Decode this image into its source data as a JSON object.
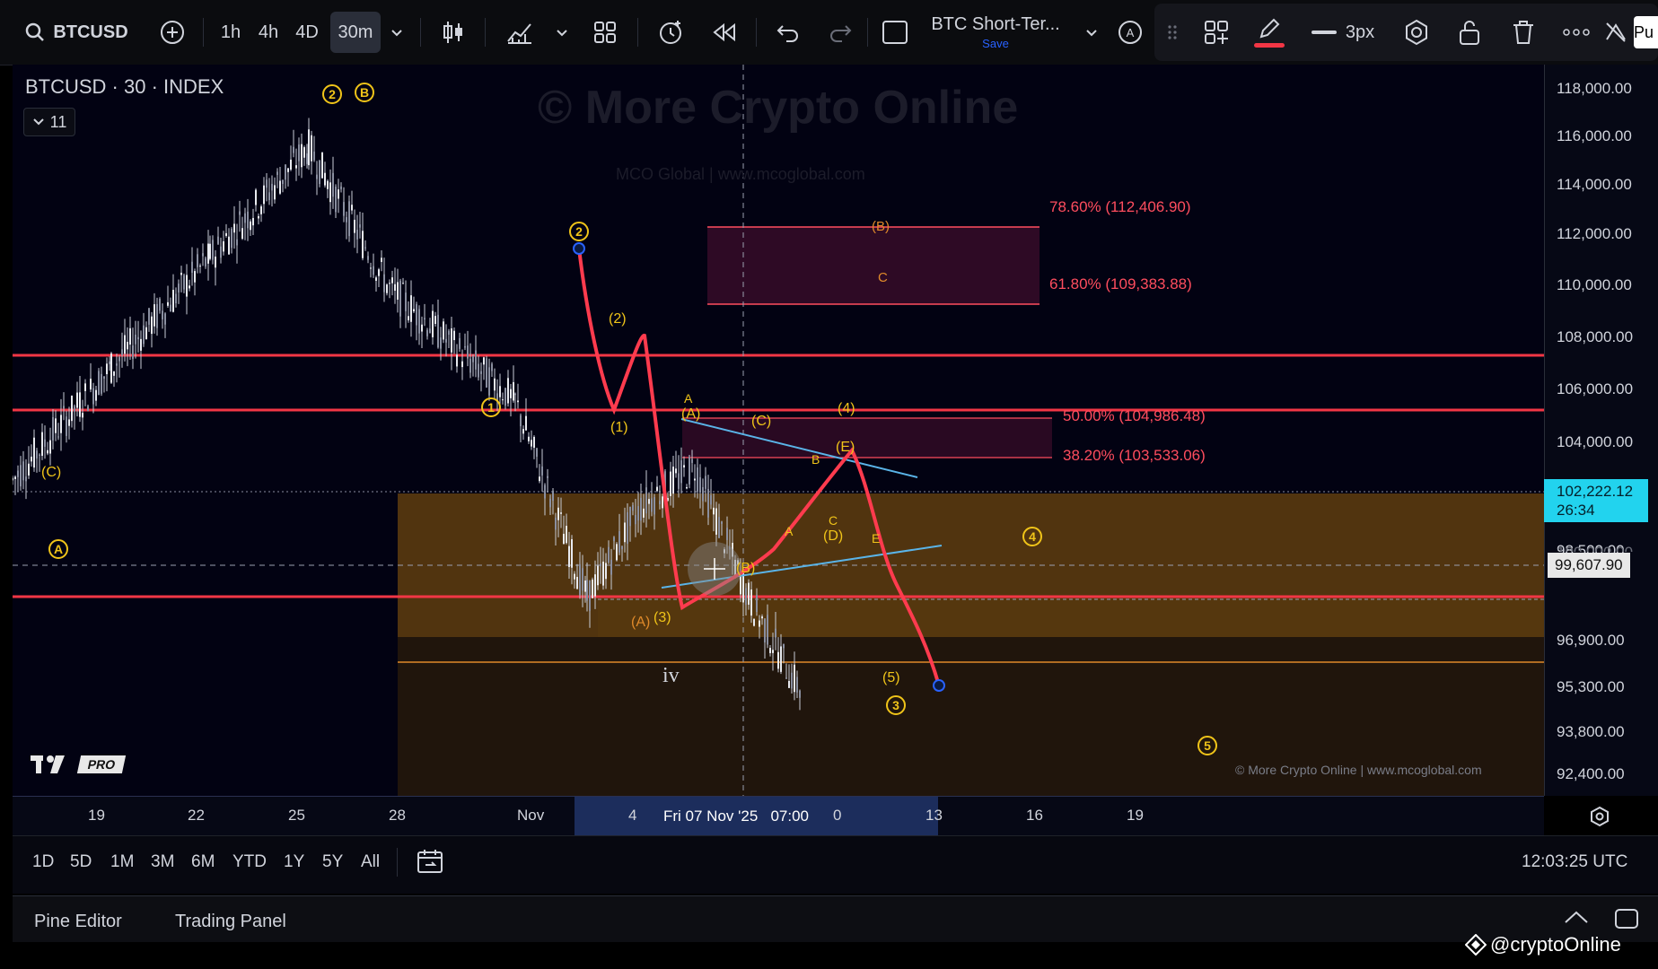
{
  "toolbar": {
    "symbol": "BTCUSD",
    "intervals": [
      "1h",
      "4h",
      "4D",
      "30m"
    ],
    "active_interval": "30m",
    "layout_name": "BTC Short-Ter...",
    "save_label": "Save",
    "stroke_width": "3px",
    "alert_letter": "A",
    "publish_label": "Pu"
  },
  "legend": {
    "title": "BTCUSD · 30 · INDEX",
    "indicator_count": "11"
  },
  "watermark": {
    "line1": "© More Crypto Online",
    "line2": "MCO Global | www.mcoglobal.com",
    "credit": "© More Crypto Online  |  www.mcoglobal.com"
  },
  "price_axis": {
    "ticks": [
      "118,000.00",
      "116,000.00",
      "114,000.00",
      "112,000.00",
      "110,000.00",
      "108,000.00",
      "106,000.00",
      "104,000.00",
      "98,500.00",
      "96,900.00",
      "95,300.00",
      "93,800.00",
      "92,400.00"
    ],
    "partial_tick": "100,000.00",
    "last_price": "102,222.12",
    "countdown": "26:34",
    "crosshair_price": "99,607.90"
  },
  "time_axis": {
    "ticks": [
      "19",
      "22",
      "25",
      "28",
      "Nov",
      "4",
      "0",
      "13",
      "16",
      "19"
    ],
    "crosshair_label": "Fri 07 Nov '25   07:00"
  },
  "range_buttons": [
    "1D",
    "5D",
    "1M",
    "3M",
    "6M",
    "YTD",
    "1Y",
    "5Y",
    "All"
  ],
  "clock": "12:03:25 UTC",
  "bottom_tabs": [
    "Pine Editor",
    "Trading Panel"
  ],
  "footer_brand": "@cryptoOnline",
  "logo_badge": "PRO",
  "fib_levels": [
    {
      "label": "78.60% (112,406.90)"
    },
    {
      "label": "61.80% (109,383.88)"
    },
    {
      "label": "50.00% (104,986.48)"
    },
    {
      "label": "38.20% (103,533.06)"
    }
  ],
  "wave_labels": {
    "circled": [
      "2",
      "B",
      "2",
      "1",
      "4",
      "3",
      "5",
      "A"
    ],
    "text": [
      "(C)",
      "(2)",
      "(1)",
      "A",
      "(A)",
      "(C)",
      "(4)",
      "B",
      "(E)",
      "C",
      "(D)",
      "A",
      "E",
      "(B)",
      "(A)",
      "(3)",
      "(5)",
      "(B)",
      "C",
      "iv"
    ]
  },
  "colors": {
    "accent": "#2962ff",
    "resistance_line": "#f23645",
    "zone_fill": "#5a3a10",
    "wave_label": "#f0c419",
    "projection": "#ff3b4e",
    "trendline": "#5ab4e8",
    "last_price_badge": "#22d3ee"
  },
  "chart_data": {
    "type": "line",
    "title": "BTCUSD · 30 · INDEX",
    "x": [
      "19",
      "22",
      "25",
      "28",
      "Nov",
      "4",
      "Fri 07 Nov '25",
      "10",
      "13",
      "16",
      "19"
    ],
    "series": [
      {
        "values": [
          103500,
          107800,
          112000,
          116200,
          110800,
          106500,
          99000,
          102500,
          104000,
          99000,
          95300
        ]
      },
      {
        "values": [
          111000,
          108500,
          104500,
          107800,
          103500,
          101500,
          98100,
          103800,
          95300
        ]
      }
    ],
    "horizontal_levels": [
      107700,
      105400,
      98500,
      96900
    ],
    "fib_retracements": [
      112406.9,
      109383.88,
      104986.48,
      103533.06
    ],
    "last_price": 102222.12,
    "ylim": [
      91800,
      119000
    ]
  }
}
